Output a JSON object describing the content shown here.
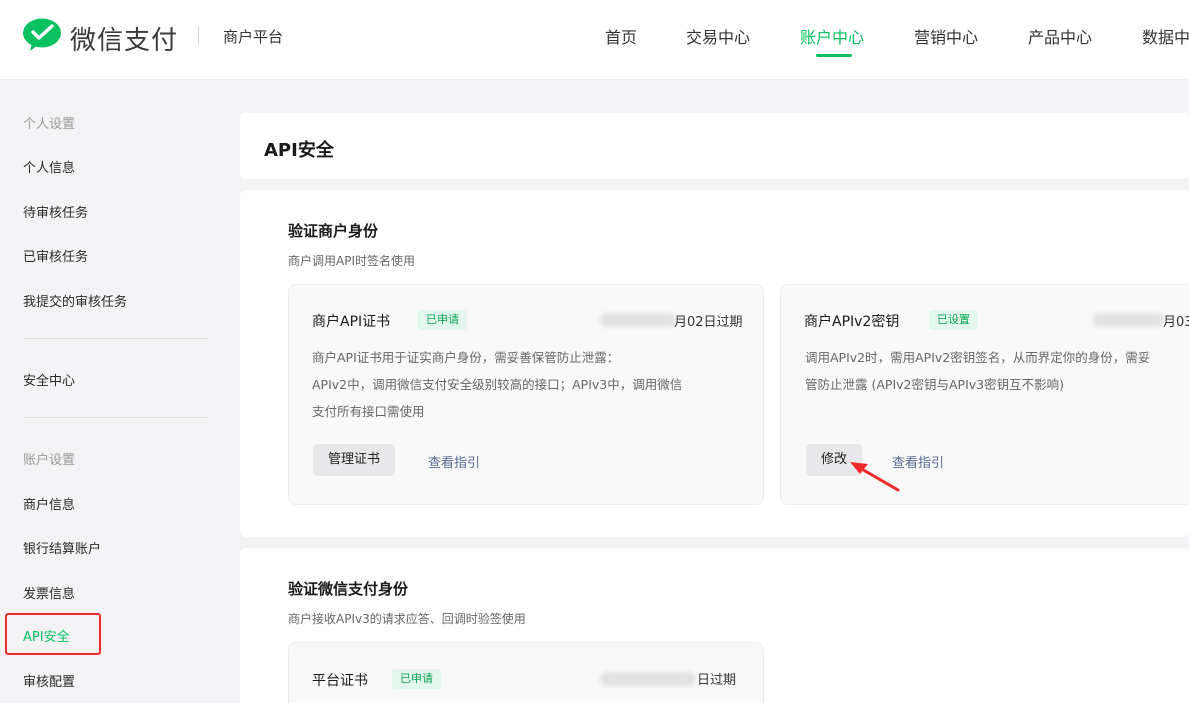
{
  "header": {
    "brand": "微信支付",
    "platform": "商户平台",
    "nav": [
      {
        "label": "首页",
        "active": false
      },
      {
        "label": "交易中心",
        "active": false
      },
      {
        "label": "账户中心",
        "active": true
      },
      {
        "label": "营销中心",
        "active": false
      },
      {
        "label": "产品中心",
        "active": false
      },
      {
        "label": "数据中",
        "active": false
      }
    ]
  },
  "sidebar": {
    "group_personal": "个人设置",
    "personal_items": [
      "个人信息",
      "待审核任务",
      "已审核任务",
      "我提交的审核任务"
    ],
    "security_center": "安全中心",
    "group_account": "账户设置",
    "account_items": [
      "商户信息",
      "银行结算账户",
      "发票信息",
      "API安全",
      "审核配置"
    ]
  },
  "main": {
    "title": "API安全",
    "verify_merchant": {
      "title": "验证商户身份",
      "subtitle": "商户调用API时签名使用",
      "cards": [
        {
          "title": "商户API证书",
          "tag": "已申请",
          "expire_text": "月02日过期",
          "desc_lines": [
            "商户API证书用于证实商户身份，需妥善保管防止泄露：",
            "APIv2中，调用微信支付安全级别较高的接口；APIv3中，调用微信",
            "支付所有接口需使用"
          ],
          "button": "管理证书",
          "link": "查看指引"
        },
        {
          "title": "商户APIv2密钥",
          "tag": "已设置",
          "expire_text": "月03",
          "desc_lines": [
            "调用APIv2时，需用APIv2密钥签名，从而界定你的身份，需妥",
            "管防止泄露 (APIv2密钥与APIv3密钥互不影响)"
          ],
          "button": "修改",
          "link": "查看指引"
        }
      ]
    },
    "verify_wechat": {
      "title": "验证微信支付身份",
      "subtitle": "商户接收APIv3的请求应答、回调时验签使用",
      "cards": [
        {
          "title": "平台证书",
          "tag": "已申请",
          "expire_text": "日过期"
        }
      ]
    }
  },
  "colors": {
    "accent": "#07c160",
    "link": "#576b95",
    "highlight": "#ef2b2b"
  }
}
